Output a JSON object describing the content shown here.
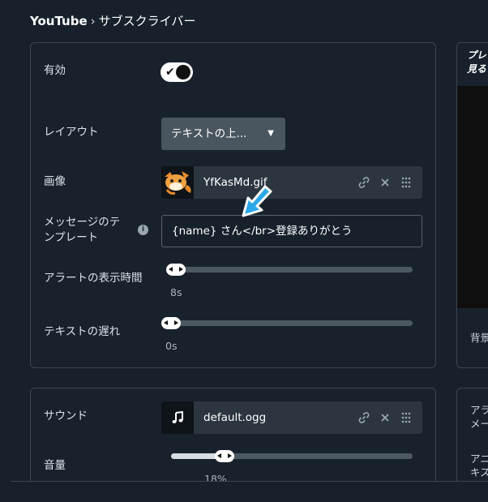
{
  "breadcrumb": {
    "root": "YouTube",
    "separator": "›",
    "current": "サブスクライバー"
  },
  "main": {
    "enabled": {
      "label": "有効",
      "value": true
    },
    "layout": {
      "label": "レイアウト",
      "value": "テキストの上..."
    },
    "image": {
      "label": "画像",
      "filename": "YfKasMd.gif"
    },
    "template": {
      "label_line1": "メッセージのテ",
      "label_line2": "ンプレート",
      "info": "i",
      "value": "{name} さん</br>登録ありがとう"
    },
    "alert_duration": {
      "label": "アラートの表示時間",
      "value": "8s",
      "fraction": 0.0
    },
    "text_delay": {
      "label": "テキストの遅れ",
      "value": "0s",
      "fraction": 0.0
    }
  },
  "sound": {
    "label": "サウンド",
    "filename": "default.ogg",
    "volume": {
      "label": "音量",
      "value": "18%",
      "fraction": 0.18
    }
  },
  "right": {
    "head_line1": "プレ",
    "head_line2": "見る",
    "bg_label": "背景",
    "item1_line1": "アラ",
    "item1_line2": "メー",
    "item2_line1": "アニ",
    "item2_line2": "キス"
  },
  "icons": {
    "link": "link-icon",
    "close": "close-icon",
    "drag": "drag-handle-icon",
    "music": "music-note-icon",
    "caret": "caret-down-icon"
  }
}
